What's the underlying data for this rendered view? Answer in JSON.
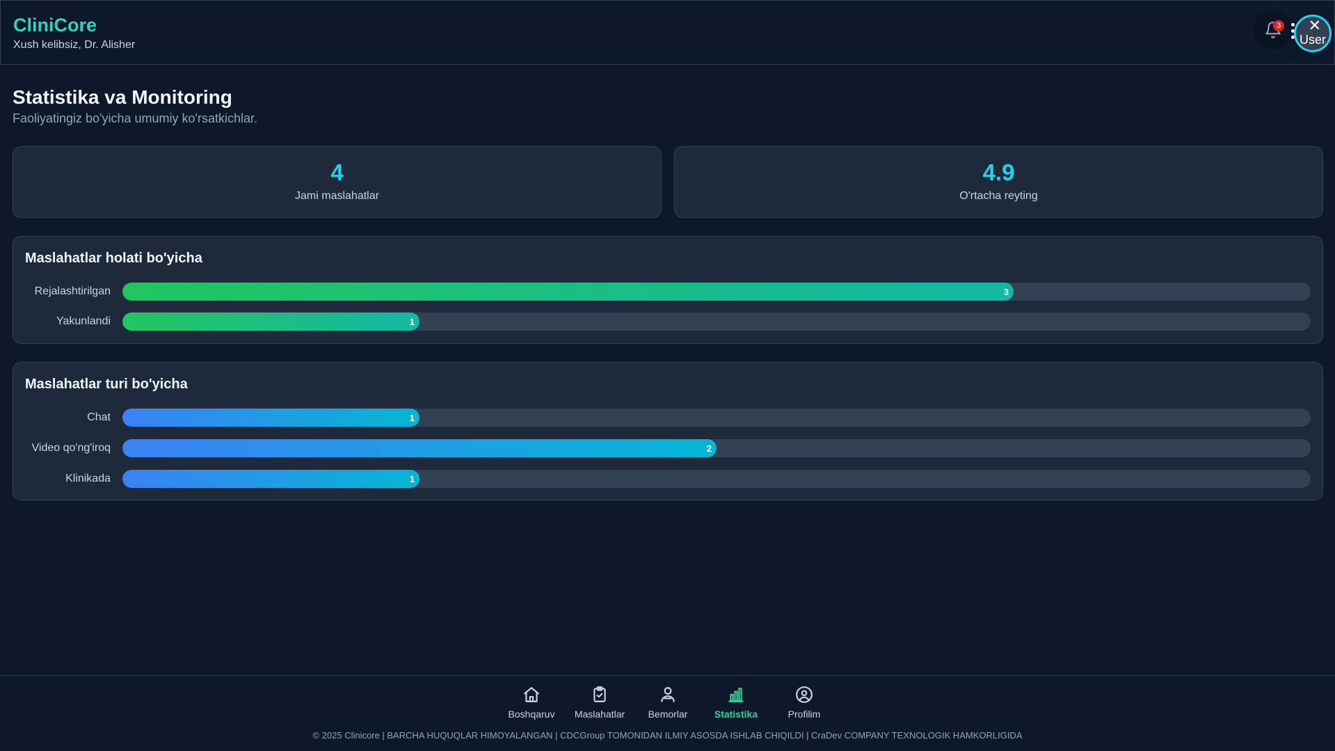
{
  "header": {
    "brand": "CliniCore",
    "welcome": "Xush kelibsiz, Dr. Alisher",
    "notifications_count": "3",
    "avatar_text": "User"
  },
  "page": {
    "title": "Statistika va Monitoring",
    "subtitle": "Faoliyatingiz bo'yicha umumiy ko'rsatkichlar."
  },
  "stats": [
    {
      "value": "4",
      "label": "Jami maslahatlar"
    },
    {
      "value": "4.9",
      "label": "O'rtacha reyting"
    }
  ],
  "chart_data": [
    {
      "type": "bar",
      "orientation": "horizontal",
      "title": "Maslahatlar holati bo'yicha",
      "categories": [
        "Rejalashtirilgan",
        "Yakunlandi"
      ],
      "values": [
        3,
        1
      ],
      "max": 4,
      "colors": [
        "#22c55e",
        "#14b8a6"
      ]
    },
    {
      "type": "bar",
      "orientation": "horizontal",
      "title": "Maslahatlar turi bo'yicha",
      "categories": [
        "Chat",
        "Video qo'ng'iroq",
        "Klinikada"
      ],
      "values": [
        1,
        2,
        1
      ],
      "max": 4,
      "colors": [
        "#3b82f6",
        "#06b6d4"
      ]
    }
  ],
  "nav": {
    "items": [
      {
        "label": "Boshqaruv",
        "icon": "home-icon"
      },
      {
        "label": "Maslahatlar",
        "icon": "clipboard-icon"
      },
      {
        "label": "Bemorlar",
        "icon": "patients-icon"
      },
      {
        "label": "Statistika",
        "icon": "bar-chart-icon",
        "active": true
      },
      {
        "label": "Profilim",
        "icon": "user-circle-icon"
      }
    ],
    "active_color": "#34d399"
  },
  "footer": {
    "text": "© 2025 Clinicore | BARCHA HUQUQLAR HIMOYALANGAN | CDCGroup TOMONIDAN ILMIY ASOSDA ISHLAB CHIQILDI | CraDev COMPANY TEXNOLOGIK HAMKORLIGIDA"
  }
}
